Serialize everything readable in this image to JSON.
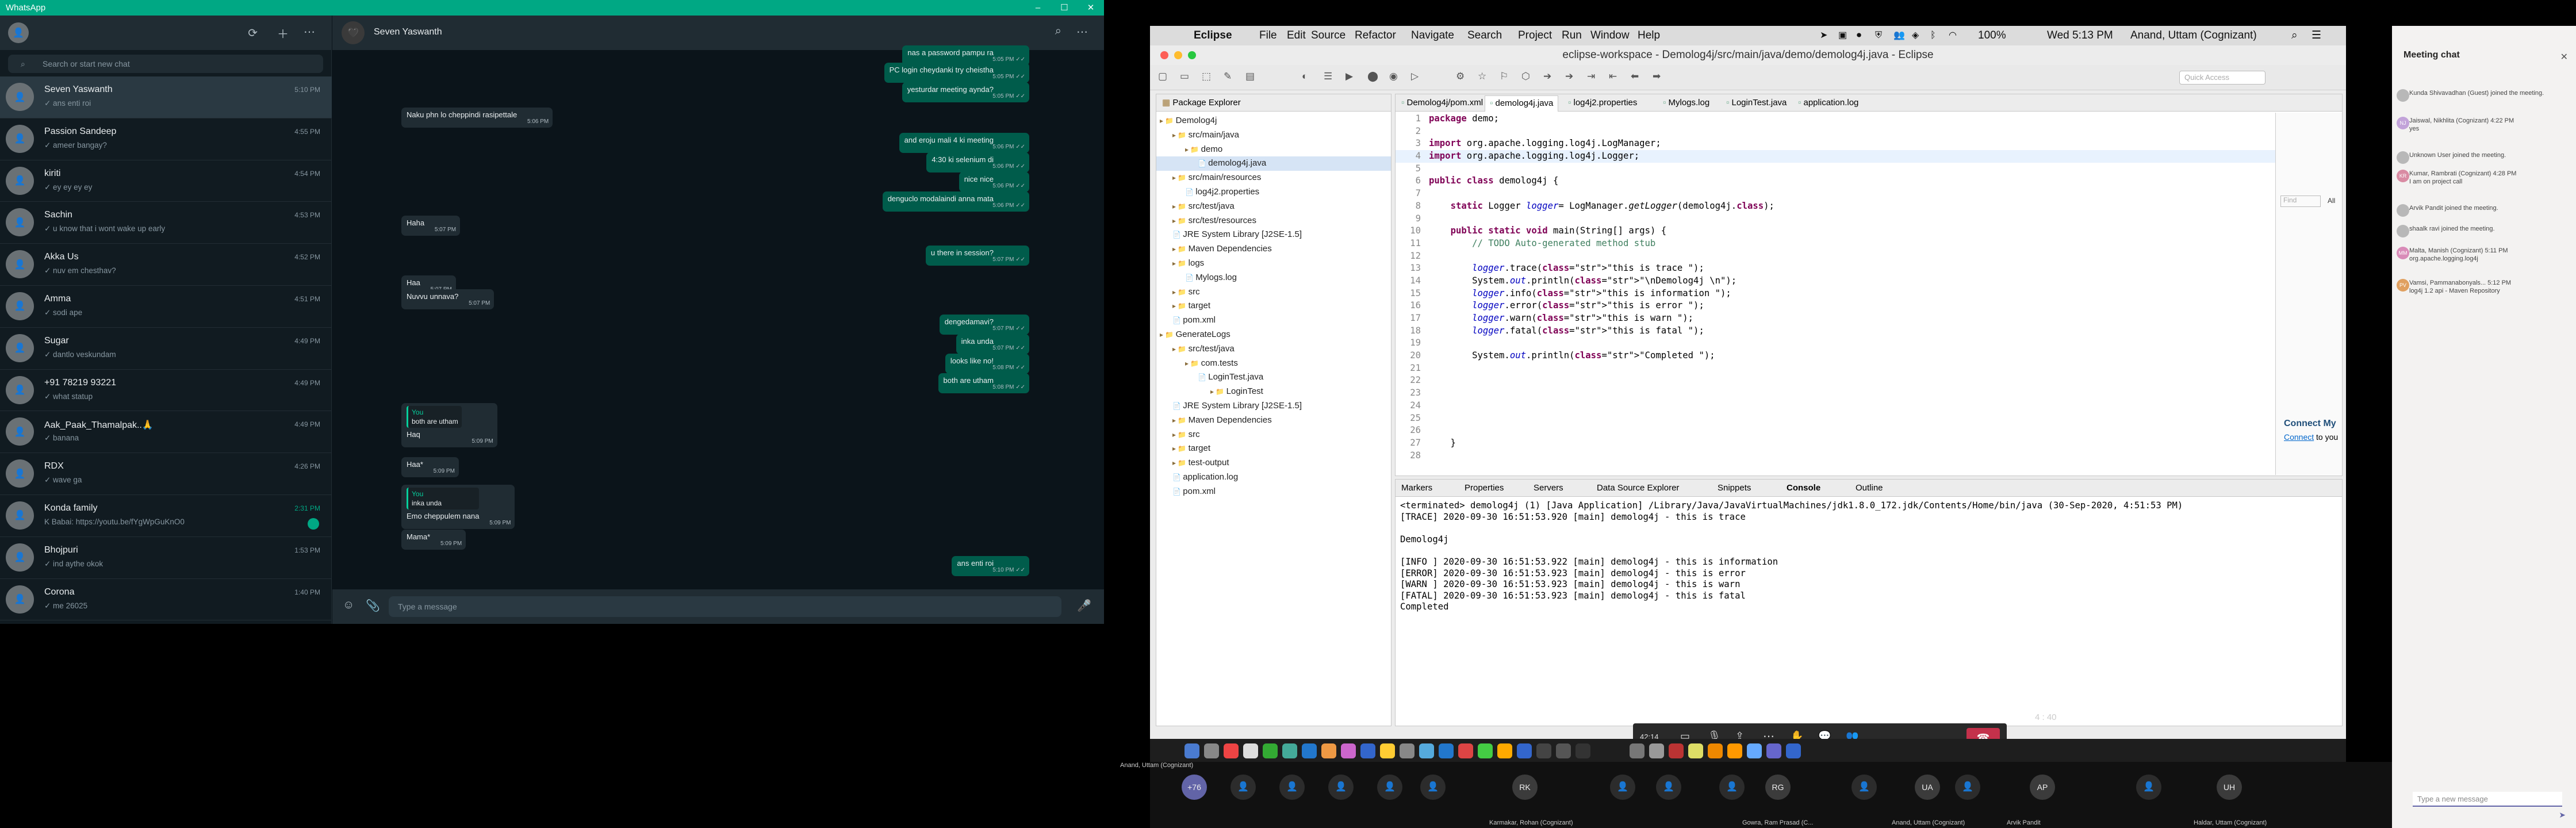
{
  "whatsapp": {
    "window_title": "WhatsApp",
    "search_placeholder": "Search or start new chat",
    "active_chat_name": "Seven Yaswanth",
    "compose_placeholder": "Type a message",
    "chats": [
      {
        "name": "Seven Yaswanth",
        "preview": "✓ ans enti roi",
        "time": "5:10 PM"
      },
      {
        "name": "Passion Sandeep",
        "preview": "✓ ameer bangay?",
        "time": "4:55 PM"
      },
      {
        "name": "kiriti",
        "preview": "✓ ey ey ey ey",
        "time": "4:54 PM"
      },
      {
        "name": "Sachin",
        "preview": "✓ u know that i wont wake up early",
        "time": "4:53 PM"
      },
      {
        "name": "Akka Us",
        "preview": "✓ nuv em chesthav?",
        "time": "4:52 PM"
      },
      {
        "name": "Amma",
        "preview": "✓ sodi ape",
        "time": "4:51 PM"
      },
      {
        "name": "Sugar",
        "preview": "✓ dantlo veskundam",
        "time": "4:49 PM"
      },
      {
        "name": "+91 78219 93221",
        "preview": "✓ what statup",
        "time": "4:49 PM"
      },
      {
        "name": "Aak_Paak_Thamalpak..🙏",
        "preview": "✓ banana",
        "time": "4:49 PM"
      },
      {
        "name": "RDX",
        "preview": "✓ wave ga",
        "time": "4:26 PM"
      },
      {
        "name": "Konda family",
        "preview": "K Babai: https://youtu.be/fYgWpGuKnO0",
        "time": "2:31 PM"
      },
      {
        "name": "Bhojpuri",
        "preview": "✓ ind aythe okok",
        "time": "1:53 PM"
      },
      {
        "name": "Corona",
        "preview": "✓ me 26025",
        "time": "1:40 PM"
      }
    ],
    "messages": [
      {
        "dir": "out",
        "text": "nas a password pampu ra",
        "time": "5:05 PM"
      },
      {
        "dir": "out",
        "text": "PC login cheydanki try cheistha",
        "time": "5:05 PM"
      },
      {
        "dir": "out",
        "text": "yesturdar meeting aynda?",
        "time": "5:05 PM"
      },
      {
        "dir": "in",
        "text": "Naku phn lo cheppindi rasipettale",
        "time": "5:06 PM"
      },
      {
        "dir": "out",
        "text": "and eroju mali 4 ki meeting",
        "time": "5:06 PM"
      },
      {
        "dir": "out",
        "text": "4:30 ki selenium di",
        "time": "5:06 PM"
      },
      {
        "dir": "out",
        "text": "nice nice",
        "time": "5:06 PM"
      },
      {
        "dir": "out",
        "text": "denguclo modalaindi anna mata",
        "time": "5:06 PM"
      },
      {
        "dir": "in",
        "text": "Haha",
        "time": "5:07 PM"
      },
      {
        "dir": "out",
        "text": "u there in session?",
        "time": "5:07 PM"
      },
      {
        "dir": "in",
        "text": "Haa",
        "time": "5:07 PM"
      },
      {
        "dir": "in",
        "text": "Nuvvu unnava?",
        "time": "5:07 PM"
      },
      {
        "dir": "out",
        "text": "dengedamavi?",
        "time": "5:07 PM"
      },
      {
        "dir": "out",
        "text": "inka unda",
        "time": "5:07 PM"
      },
      {
        "dir": "out",
        "text": "looks like no!",
        "time": "5:08 PM"
      },
      {
        "dir": "out",
        "text": "both are utham",
        "time": "5:08 PM"
      },
      {
        "dir": "in",
        "quote_author": "You",
        "quote": "both are utham",
        "text": "Haq",
        "time": "5:09 PM"
      },
      {
        "dir": "in",
        "text": "Haa*",
        "time": "5:09 PM"
      },
      {
        "dir": "in",
        "quote_author": "You",
        "quote": "inka unda",
        "text": "Emo cheppulem nana",
        "time": "5:09 PM"
      },
      {
        "dir": "in",
        "text": "Mama*",
        "time": "5:09 PM"
      },
      {
        "dir": "out",
        "text": "ans enti roi",
        "time": "5:10 PM"
      }
    ]
  },
  "mac_menubar": {
    "app": "Eclipse",
    "menus": [
      "File",
      "Edit",
      "Source",
      "Refactor",
      "Navigate",
      "Search",
      "Project",
      "Run",
      "Window",
      "Help"
    ],
    "battery": "100%",
    "clock": "Wed 5:13 PM",
    "user": "Anand, Uttam (Cognizant)"
  },
  "eclipse": {
    "window_title": "eclipse-workspace - Demolog4j/src/main/java/demo/demolog4j.java - Eclipse",
    "quick_access": "Quick Access",
    "package_explorer_title": "Package Explorer",
    "tree": [
      {
        "indent": 0,
        "label": "Demolog4j"
      },
      {
        "indent": 1,
        "label": "src/main/java"
      },
      {
        "indent": 2,
        "label": "demo"
      },
      {
        "indent": 3,
        "label": "demolog4j.java"
      },
      {
        "indent": 1,
        "label": "src/main/resources"
      },
      {
        "indent": 2,
        "label": "log4j2.properties"
      },
      {
        "indent": 1,
        "label": "src/test/java"
      },
      {
        "indent": 1,
        "label": "src/test/resources"
      },
      {
        "indent": 1,
        "label": "JRE System Library [J2SE-1.5]"
      },
      {
        "indent": 1,
        "label": "Maven Dependencies"
      },
      {
        "indent": 1,
        "label": "logs"
      },
      {
        "indent": 2,
        "label": "Mylogs.log"
      },
      {
        "indent": 1,
        "label": "src"
      },
      {
        "indent": 1,
        "label": "target"
      },
      {
        "indent": 1,
        "label": "pom.xml"
      },
      {
        "indent": 0,
        "label": "GenerateLogs"
      },
      {
        "indent": 1,
        "label": "src/test/java"
      },
      {
        "indent": 2,
        "label": "com.tests"
      },
      {
        "indent": 3,
        "label": "LoginTest.java"
      },
      {
        "indent": 4,
        "label": "LoginTest"
      },
      {
        "indent": 1,
        "label": "JRE System Library [J2SE-1.5]"
      },
      {
        "indent": 1,
        "label": "Maven Dependencies"
      },
      {
        "indent": 1,
        "label": "src"
      },
      {
        "indent": 1,
        "label": "target"
      },
      {
        "indent": 1,
        "label": "test-output"
      },
      {
        "indent": 1,
        "label": "application.log"
      },
      {
        "indent": 1,
        "label": "pom.xml"
      }
    ],
    "editor_tabs": [
      "Demolog4j/pom.xml",
      "demolog4j.java",
      "log4j2.properties",
      "Mylogs.log",
      "LoginTest.java",
      "application.log"
    ],
    "code": [
      "package demo;",
      "",
      "import org.apache.logging.log4j.LogManager;",
      "import org.apache.logging.log4j.Logger;",
      "",
      "public class demolog4j {",
      "",
      "    static Logger logger= LogManager.getLogger(demolog4j.class);",
      "",
      "    public static void main(String[] args) {",
      "        // TODO Auto-generated method stub",
      "",
      "        logger.trace(\"this is trace \");",
      "        System.out.println(\"\\nDemolog4j \\n\");",
      "        logger.info(\"this is information \");",
      "        logger.error(\"this is error \");",
      "        logger.warn(\"this is warn \");",
      "        logger.fatal(\"this is fatal \");",
      "",
      "        System.out.println(\"Completed \");",
      "",
      "",
      "",
      "",
      "",
      "",
      "    }",
      ""
    ],
    "bottom_tabs": [
      "Markers",
      "Properties",
      "Servers",
      "Data Source Explorer",
      "Snippets",
      "Console",
      "Outline"
    ],
    "console": [
      "<terminated> demolog4j (1) [Java Application] /Library/Java/JavaVirtualMachines/jdk1.8.0_172.jdk/Contents/Home/bin/java (30-Sep-2020, 4:51:53 PM)",
      "[TRACE] 2020-09-30 16:51:53.920 [main] demolog4j - this is trace",
      "",
      "Demolog4j",
      "",
      "[INFO ] 2020-09-30 16:51:53.922 [main] demolog4j - this is information",
      "[ERROR] 2020-09-30 16:51:53.923 [main] demolog4j - this is error",
      "[WARN ] 2020-09-30 16:51:53.923 [main] demolog4j - this is warn",
      "[FATAL] 2020-09-30 16:51:53.923 [main] demolog4j - this is fatal",
      "Completed"
    ],
    "status_position": "4 : 40",
    "connect_title": "Connect My",
    "connect_link": "Connect",
    "connect_rest": " to you",
    "find_placeholder": "Find",
    "find_all": "All"
  },
  "teams": {
    "panel_title": "Meeting chat",
    "messages": [
      {
        "initials": "",
        "text": "Kunda Shivavadhan (Guest) joined the meeting.",
        "time": "",
        "color": "#b8b8b8"
      },
      {
        "initials": "NJ",
        "text": "Jaiswal, Nikhlita (Cognizant)  4:22 PM\nyes",
        "time": "",
        "color": "#c2a3d9"
      },
      {
        "initials": "",
        "text": "Unknown User joined the meeting.",
        "time": "",
        "color": "#b8b8b8"
      },
      {
        "initials": "KR",
        "text": "Kumar, Rambrati (Cognizant)  4:28 PM\nI am on project call",
        "time": "",
        "color": "#d98ba3"
      },
      {
        "initials": "",
        "text": "Arvik Pandit joined the meeting.",
        "time": "",
        "color": "#b8b8b8"
      },
      {
        "initials": "",
        "text": "shaalk ravi joined the meeting.",
        "time": "",
        "color": "#b8b8b8"
      },
      {
        "initials": "MM",
        "text": "Malta, Manish (Cognizant)  5:11 PM\norg.apache.logging.log4j",
        "time": "",
        "color": "#d98bb8"
      },
      {
        "initials": "PV",
        "text": "Vamsi, Pammanabonyals...  5:12 PM\nlog4j 1.2 api - Maven Repository",
        "time": "",
        "color": "#e0a060"
      }
    ],
    "compose_placeholder": "Type a new message",
    "call_timer": "42:14",
    "participants": [
      {
        "initials": "+76",
        "name": ""
      },
      {
        "initials": "RK",
        "name": "Karmakar, Rohan (Cognizant)"
      },
      {
        "initials": "RG",
        "name": "Gowra, Ram Prasad (C..."
      },
      {
        "initials": "UA",
        "name": "Anand, Uttam (Cognizant)"
      },
      {
        "initials": "AP",
        "name": "Arvik Pandit"
      },
      {
        "initials": "UH",
        "name": "Haldar, Uttam (Cognizant)"
      }
    ],
    "self_label": "Anand, Uttam (Cognizant)"
  }
}
